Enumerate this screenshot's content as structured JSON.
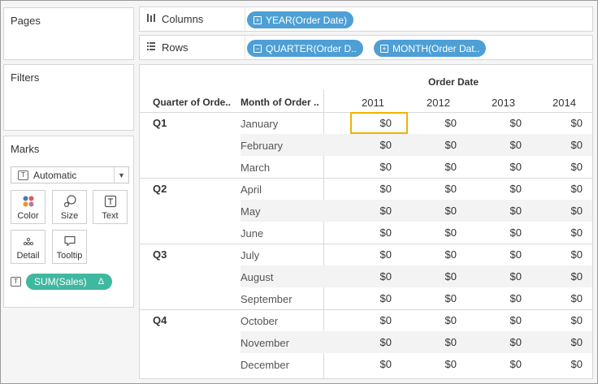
{
  "left_panel": {
    "pages_title": "Pages",
    "filters_title": "Filters",
    "marks_title": "Marks",
    "mark_type": "Automatic",
    "mark_type_icon": "T",
    "buttons": {
      "color": "Color",
      "size": "Size",
      "text": "Text",
      "detail": "Detail",
      "tooltip": "Tooltip"
    },
    "sales_pill": {
      "icon": "T",
      "label": "SUM(Sales)",
      "delta": "Δ"
    }
  },
  "shelves": {
    "columns_label": "Columns",
    "rows_label": "Rows",
    "columns_pills": [
      "YEAR(Order Date)"
    ],
    "rows_pills": [
      "QUARTER(Order D..",
      "MONTH(Order Dat.."
    ],
    "plus_sign": "+",
    "minus_sign": "−"
  },
  "view": {
    "super_header": "Order Date",
    "row_headers": [
      "Quarter of Orde..",
      "Month of Order .."
    ],
    "years": [
      "2011",
      "2012",
      "2013",
      "2014"
    ],
    "quarters": [
      {
        "label": "Q1",
        "months": [
          "January",
          "February",
          "March"
        ]
      },
      {
        "label": "Q2",
        "months": [
          "April",
          "May",
          "June"
        ]
      },
      {
        "label": "Q3",
        "months": [
          "July",
          "August",
          "September"
        ]
      },
      {
        "label": "Q4",
        "months": [
          "October",
          "November",
          "December"
        ]
      }
    ],
    "cell_value": "$0",
    "selected_cell": {
      "month": "January",
      "year": "2011"
    },
    "colors": {
      "teal_pill": "#3fb8a0",
      "blue_pill": "#4d9fd6",
      "selection": "#f0b400"
    }
  }
}
